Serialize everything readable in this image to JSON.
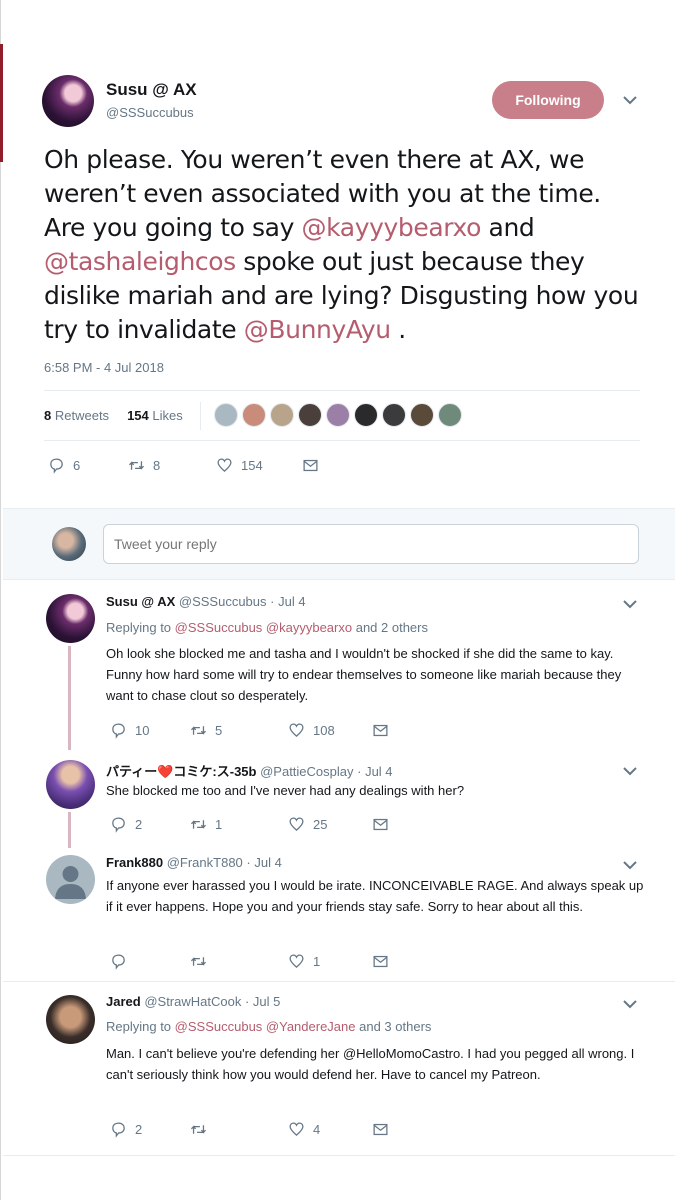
{
  "main_tweet": {
    "name": "Susu @ AX",
    "handle": "@SSSuccubus",
    "follow_label": "Following",
    "text_parts": [
      "Oh please. You weren’t even there at AX, we weren’t even associated with you at the time. Are you going to say ",
      "@kayyybearxo",
      " and ",
      "@tashaleighcos",
      " spoke out just because they dislike mariah and are lying? Disgusting how you try to invalidate ",
      "@BunnyAyu",
      " ."
    ],
    "timestamp": "6:58 PM - 4 Jul 2018",
    "retweets_count": "8",
    "retweets_label": "Retweets",
    "likes_count": "154",
    "likes_label": "Likes",
    "liker_colors": [
      "#aab8c2",
      "#c98c7a",
      "#b8a48a",
      "#4a3f3a",
      "#9b7fa6",
      "#2a2a2a",
      "#3b3b3b",
      "#5a4a3a",
      "#6f8a7a"
    ],
    "actions": {
      "replies": "6",
      "retweets": "8",
      "likes": "154"
    }
  },
  "reply_box": {
    "placeholder": "Tweet your reply"
  },
  "replies": [
    {
      "name": "Susu @ AX",
      "handle": "@SSSuccubus",
      "date": "Jul 4",
      "replying_prefix": "Replying to",
      "replying_to": "@SSSuccubus @kayyybearxo",
      "replying_suffix": "and 2 others",
      "text": "Oh look she blocked me and tasha and I wouldn't be shocked if she did the same to kay. Funny how hard some will try to endear themselves to someone like mariah because they want to chase clout so desperately.",
      "replies": "10",
      "retweets": "5",
      "likes": "108"
    },
    {
      "name": "パティー❤️コミケ:ス-35b",
      "handle": "@PattieCosplay",
      "date": "Jul 4",
      "text": "She blocked me too and I've never had any dealings with her?",
      "replies": "2",
      "retweets": "1",
      "likes": "25"
    },
    {
      "name": "Frank880",
      "handle": "@FrankT880",
      "date": "Jul 4",
      "text": "If anyone ever harassed you I would be irate. INCONCEIVABLE RAGE. And always speak up if it ever happens. Hope you and your friends stay safe. Sorry to hear about all this.",
      "replies": "",
      "retweets": "",
      "likes": "1"
    },
    {
      "name": "Jared",
      "handle": "@StrawHatCook",
      "date": "Jul 5",
      "replying_prefix": "Replying to",
      "replying_to": "@SSSuccubus @YandereJane",
      "replying_suffix": "and 3 others",
      "text": "Man. I can't believe you're defending her @HelloMomoCastro. I had you pegged all wrong. I can't seriously think how you would defend her. Have to cancel my Patreon.",
      "replies": "2",
      "retweets": "",
      "likes": "4"
    }
  ],
  "colors": {
    "accent": "#b55d6e",
    "follow_button": "#c97f8a",
    "muted": "#657786",
    "thread_line": "#d9b7c0"
  },
  "icons": [
    "chevron-down-icon",
    "reply-icon",
    "retweet-icon",
    "like-icon",
    "message-icon",
    "default-avatar-icon"
  ]
}
